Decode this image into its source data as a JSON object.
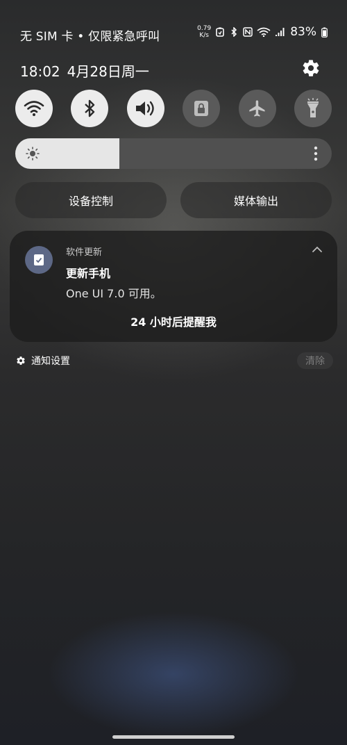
{
  "status_bar": {
    "carrier_text": "无 SIM 卡 • 仅限紧急呼叫",
    "net_speed_value": "0.79",
    "net_speed_unit": "K/s",
    "battery_percent": "83%",
    "icons": [
      "data-saver-icon",
      "bluetooth-icon",
      "nfc-icon",
      "wifi-icon",
      "signal-icon",
      "battery-icon"
    ]
  },
  "header": {
    "time": "18:02",
    "date": "4月28日周一"
  },
  "quick_settings": {
    "tiles": [
      {
        "name": "wifi",
        "state": "on"
      },
      {
        "name": "bluetooth",
        "state": "on"
      },
      {
        "name": "sound",
        "state": "on"
      },
      {
        "name": "rotation-lock",
        "state": "off"
      },
      {
        "name": "airplane-mode",
        "state": "off"
      },
      {
        "name": "flashlight",
        "state": "off"
      }
    ]
  },
  "brightness": {
    "level": 0.33
  },
  "controls": {
    "device_control": "设备控制",
    "media_output": "媒体输出"
  },
  "notification": {
    "app_name": "软件更新",
    "title": "更新手机",
    "body": "One UI 7.0 可用。",
    "action": "24 小时后提醒我"
  },
  "footer": {
    "notif_settings": "通知设置",
    "clear": "清除"
  },
  "colors": {
    "tile_on": "#ececec",
    "tile_off": "#5a5a5a",
    "app_icon_bg": "#5d6886"
  }
}
